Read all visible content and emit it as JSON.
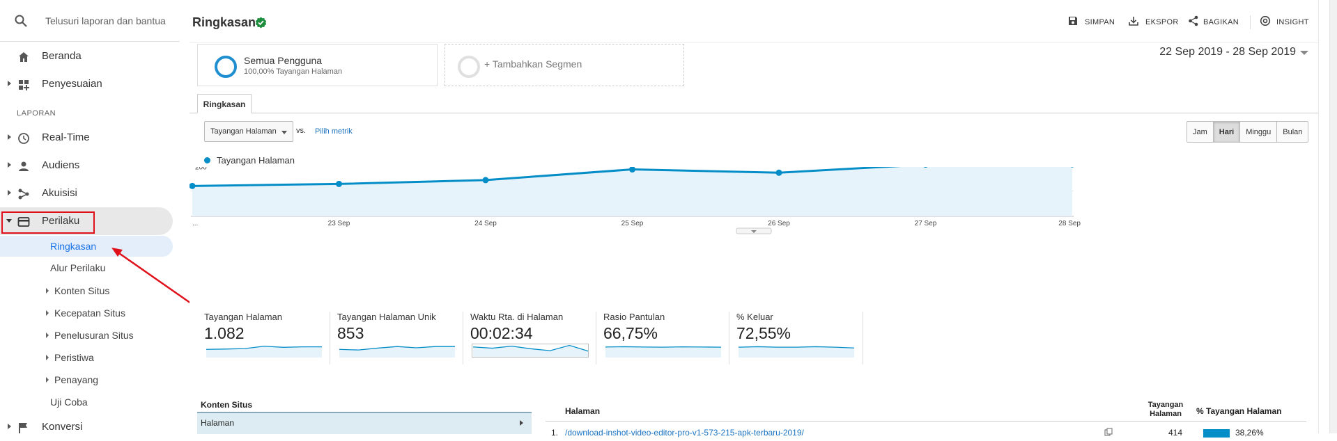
{
  "sidebar": {
    "search_placeholder": "Telusuri laporan dan bantua",
    "top_items": [
      {
        "label": "Beranda",
        "icon": "home-icon"
      },
      {
        "label": "Penyesuaian",
        "icon": "dashboard-icon"
      }
    ],
    "section_label": "LAPORAN",
    "report_items": [
      {
        "label": "Real-Time",
        "icon": "clock-icon"
      },
      {
        "label": "Audiens",
        "icon": "person-icon"
      },
      {
        "label": "Akuisisi",
        "icon": "acquisition-icon"
      },
      {
        "label": "Perilaku",
        "icon": "behavior-icon",
        "expanded": true
      }
    ],
    "sub_items": [
      {
        "label": "Ringkasan",
        "selected": true
      },
      {
        "label": "Alur Perilaku"
      },
      {
        "label": "Konten Situs",
        "expandable": true
      },
      {
        "label": "Kecepatan Situs",
        "expandable": true
      },
      {
        "label": "Penelusuran Situs",
        "expandable": true
      },
      {
        "label": "Peristiwa",
        "expandable": true
      },
      {
        "label": "Penayang",
        "expandable": true
      },
      {
        "label": "Uji Coba"
      }
    ],
    "after_items": [
      {
        "label": "Konversi",
        "icon": "flag-icon"
      }
    ]
  },
  "header": {
    "title": "Ringkasan",
    "actions": {
      "save": "SIMPAN",
      "export": "EKSPOR",
      "share": "BAGIKAN",
      "insight": "INSIGHT"
    }
  },
  "segments": {
    "all_users_name": "Semua Pengguna",
    "all_users_sub": "100,00% Tayangan Halaman",
    "add_segment": "+ Tambahkan Segmen"
  },
  "date_range": "22 Sep 2019 - 28 Sep 2019",
  "tab_label": "Ringkasan",
  "chart_controls": {
    "metric_select": "Tayangan Halaman",
    "vs_label": "vs.",
    "pick_metric": "Pilih metrik",
    "periods": [
      {
        "label": "Jam",
        "active": false
      },
      {
        "label": "Hari",
        "active": true
      },
      {
        "label": "Minggu",
        "active": false
      },
      {
        "label": "Bulan",
        "active": false
      }
    ]
  },
  "chart_data": {
    "type": "area",
    "series": [
      {
        "name": "Tayangan Halaman",
        "values": [
          119,
          127,
          142,
          184,
          171,
          203,
          204
        ]
      }
    ],
    "x": [
      "...",
      "23 Sep",
      "24 Sep",
      "25 Sep",
      "26 Sep",
      "27 Sep",
      "28 Sep"
    ],
    "yticks": [
      "100",
      "200",
      "300"
    ],
    "ylim": [
      0,
      300
    ],
    "color": "#058dc7",
    "grid": true,
    "legend": "top-left"
  },
  "scorecards": [
    {
      "label": "Tayangan Halaman",
      "value": "1.082",
      "spark": [
        3,
        3.2,
        3.5,
        5,
        4.3,
        4.6,
        4.6
      ]
    },
    {
      "label": "Tayangan Halaman Unik",
      "value": "853",
      "spark": [
        3,
        2.6,
        3.8,
        4.8,
        4,
        4.8,
        4.8
      ]
    },
    {
      "label": "Waktu Rta. di Halaman",
      "value": "00:02:34",
      "spark": [
        5,
        4.2,
        5.5,
        3.8,
        2.6,
        6,
        2.2
      ]
    },
    {
      "label": "Rasio Pantulan",
      "value": "66,75%",
      "spark": [
        4.5,
        4.7,
        4.5,
        4.4,
        4.6,
        4.5,
        4.4
      ]
    },
    {
      "label": "% Keluar",
      "value": "72,55%",
      "spark": [
        4.4,
        4.7,
        4.4,
        4.4,
        4.7,
        4.4,
        3.9
      ]
    }
  ],
  "site_content": {
    "title": "Konten Situs",
    "row": "Halaman"
  },
  "pages_table": {
    "col_page": "Halaman",
    "col_views": "Tayangan Halaman",
    "col_pct": "% Tayangan Halaman",
    "rows": [
      {
        "num": "1.",
        "page": "/download-inshot-video-editor-pro-v1-573-215-apk-terbaru-2019/",
        "views": "414",
        "pct": "38,26%",
        "share": 0.3826
      }
    ]
  }
}
